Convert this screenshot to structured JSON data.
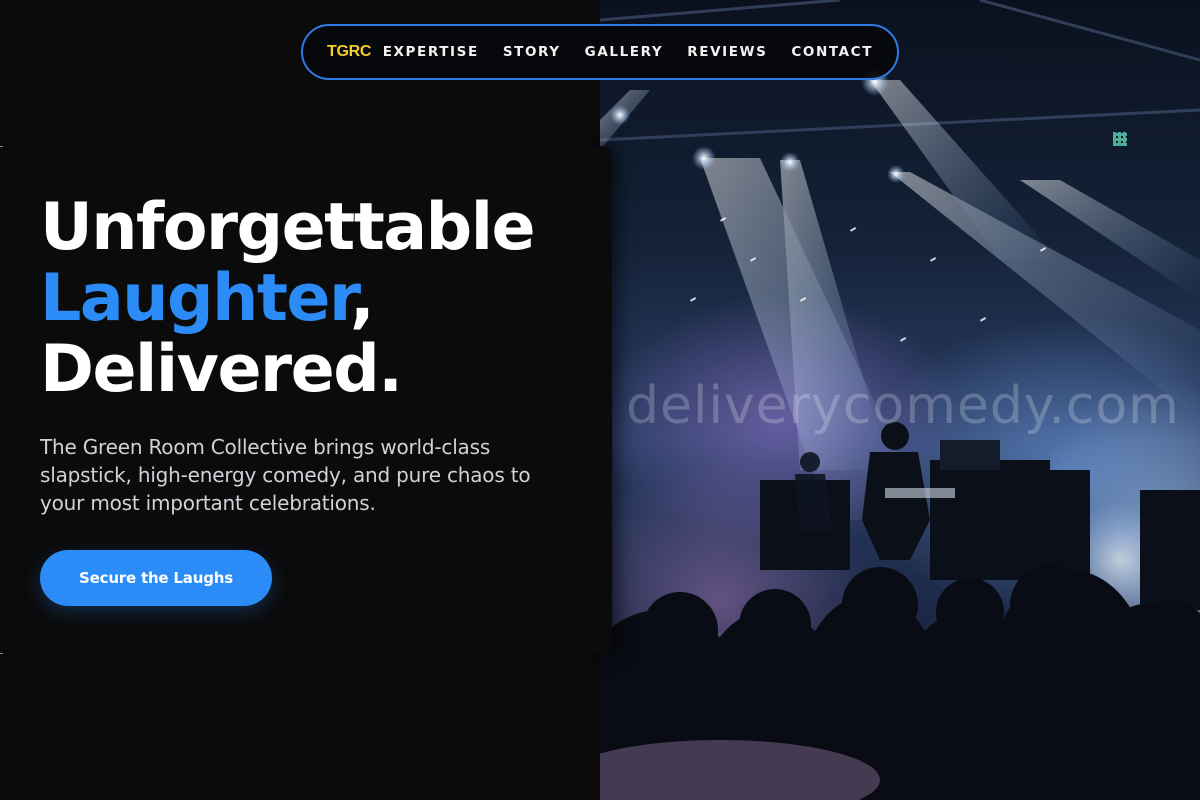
{
  "brand": {
    "logo_text": "TGRC",
    "logo_color": "#f5cc2a",
    "accent": "#2b8cf7"
  },
  "nav": {
    "links": [
      {
        "label": "EXPERTISE"
      },
      {
        "label": "STORY"
      },
      {
        "label": "GALLERY"
      },
      {
        "label": "REVIEWS"
      },
      {
        "label": "CONTACT"
      }
    ]
  },
  "hero": {
    "headline_line1": "Unforgettable",
    "headline_accent": "Laughter",
    "headline_comma": ",",
    "headline_line3": "Delivered.",
    "subtitle": "The Green Room Collective brings world-class slapstick, high-energy comedy, and pure chaos to your most important celebrations.",
    "cta_label": "Secure the Laughs"
  },
  "hero_image": {
    "subject": "concert-stage-photo",
    "watermark_text": "deliverycomedy.com"
  }
}
